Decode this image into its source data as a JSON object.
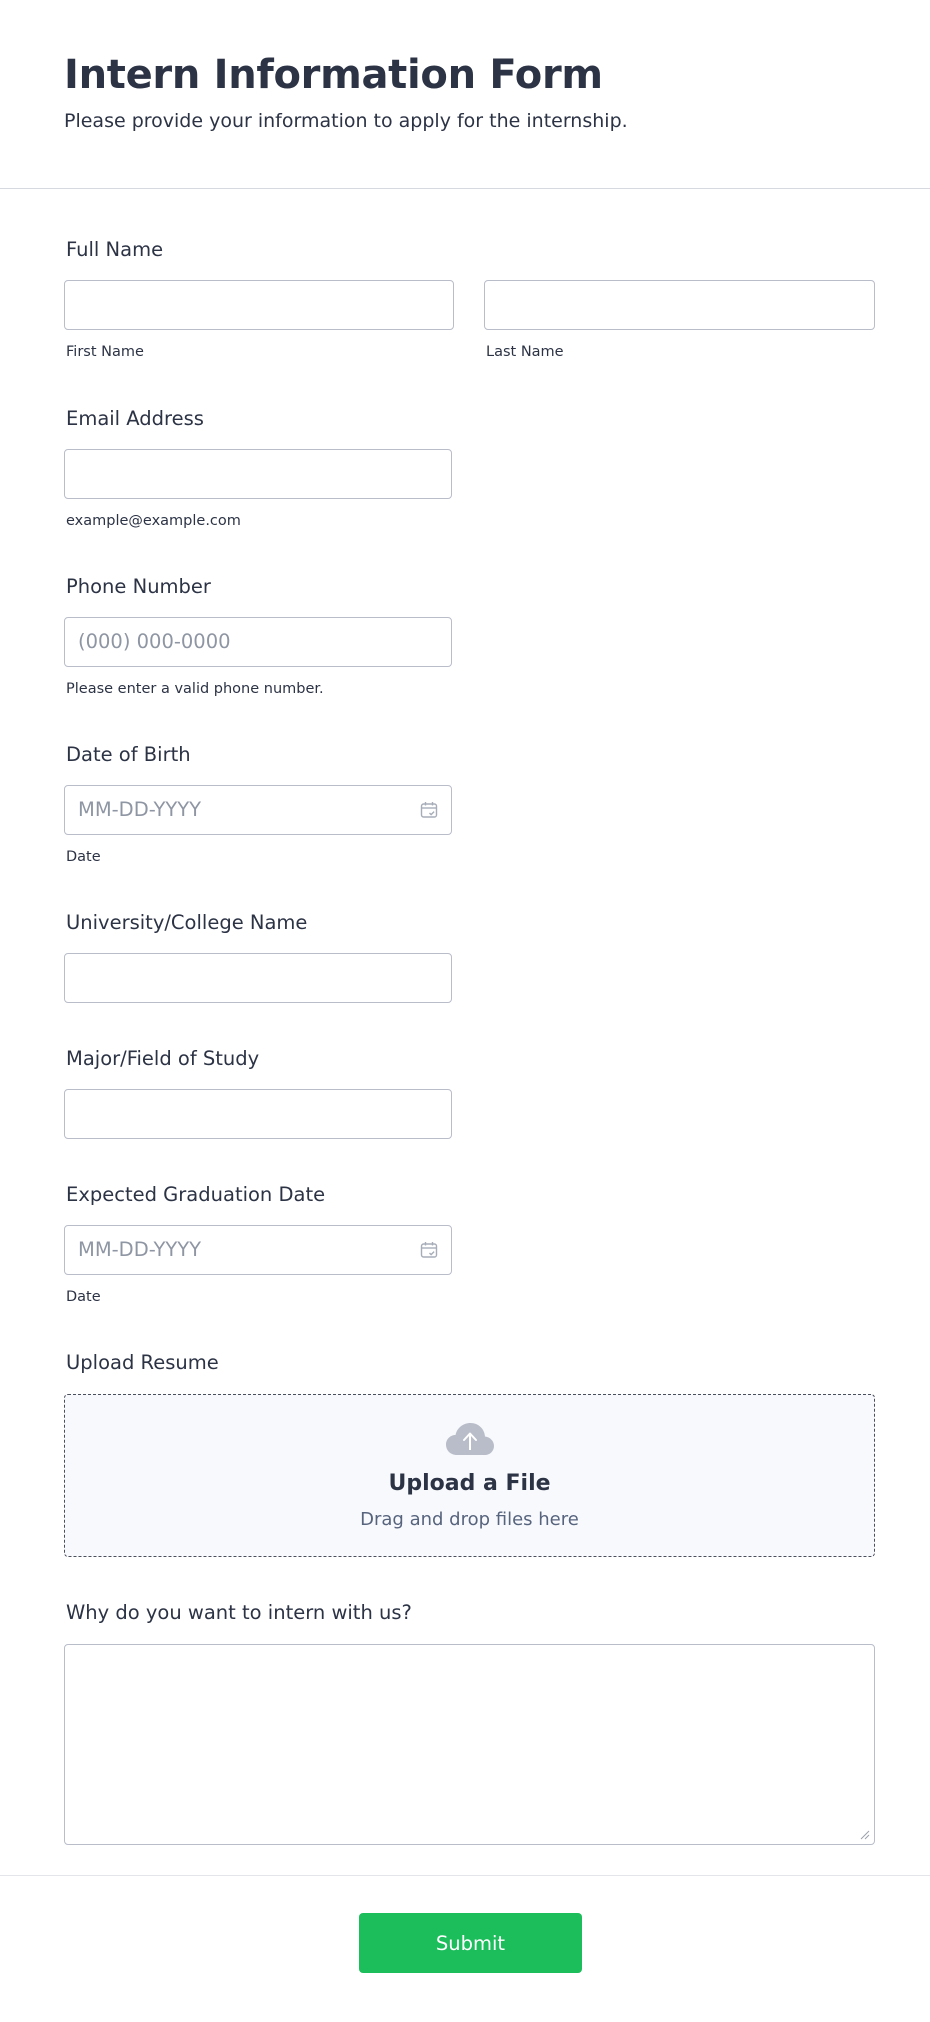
{
  "header": {
    "title": "Intern Information Form",
    "subtitle": "Please provide your information to apply for the internship."
  },
  "fields": {
    "full_name": {
      "label": "Full Name",
      "first_sublabel": "First Name",
      "last_sublabel": "Last Name",
      "first_value": "",
      "last_value": ""
    },
    "email": {
      "label": "Email Address",
      "value": "",
      "sublabel": "example@example.com"
    },
    "phone": {
      "label": "Phone Number",
      "placeholder": "(000) 000-0000",
      "sublabel": "Please enter a valid phone number."
    },
    "dob": {
      "label": "Date of Birth",
      "placeholder": "MM-DD-YYYY",
      "sublabel": "Date",
      "icon": "calendar-icon"
    },
    "university": {
      "label": "University/College Name",
      "value": ""
    },
    "major": {
      "label": "Major/Field of Study",
      "value": ""
    },
    "graduation": {
      "label": "Expected Graduation Date",
      "placeholder": "MM-DD-YYYY",
      "sublabel": "Date",
      "icon": "calendar-icon"
    },
    "resume": {
      "label": "Upload Resume",
      "title": "Upload a File",
      "hint": "Drag and drop files here",
      "icon": "cloud-upload-icon"
    },
    "why": {
      "label": "Why do you want to intern with us?",
      "value": ""
    }
  },
  "footer": {
    "submit_label": "Submit"
  },
  "colors": {
    "accent": "#1cbd5b",
    "text": "#2c3345",
    "border": "#b8bdc9",
    "placeholder": "#8f96a3"
  }
}
